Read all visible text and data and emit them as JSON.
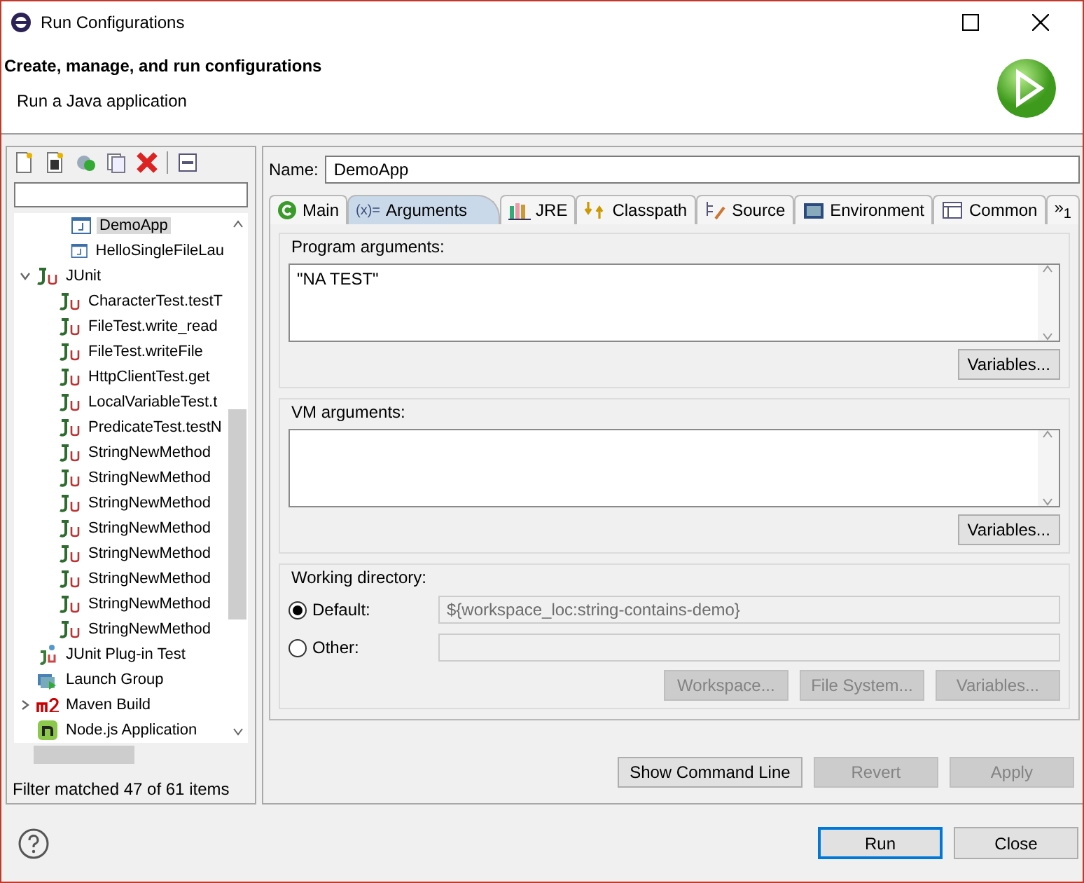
{
  "window": {
    "title": "Run Configurations"
  },
  "header": {
    "title": "Create, manage, and run configurations",
    "subtitle": "Run a Java application"
  },
  "toolbar": {
    "buttons": [
      {
        "kind": "new"
      },
      {
        "kind": "prototype"
      },
      {
        "kind": "duplicate"
      },
      {
        "kind": "export"
      },
      {
        "kind": "delete"
      },
      {
        "kind": "collapse"
      }
    ]
  },
  "tree": [
    {
      "children": [
        {
          "label": "DemoApp",
          "kind": "java",
          "selected": true
        },
        {
          "label": "HelloSingleFileLau",
          "kind": "java",
          "selected": false
        }
      ]
    },
    {
      "label": "JUnit",
      "kind": "junit",
      "selected": false,
      "expanded": true,
      "children": [
        {
          "label": "CharacterTest.testT",
          "kind": "junit",
          "selected": false
        },
        {
          "label": "FileTest.write_read",
          "kind": "junit",
          "selected": false
        },
        {
          "label": "FileTest.writeFile",
          "kind": "junit",
          "selected": false
        },
        {
          "label": "HttpClientTest.get",
          "kind": "junit",
          "selected": false
        },
        {
          "label": "LocalVariableTest.t",
          "kind": "junit",
          "selected": false
        },
        {
          "label": "PredicateTest.testN",
          "kind": "junit",
          "selected": false
        },
        {
          "label": "StringNewMethod",
          "kind": "junit",
          "selected": false
        },
        {
          "label": "StringNewMethod",
          "kind": "junit",
          "selected": false
        },
        {
          "label": "StringNewMethod",
          "kind": "junit",
          "selected": false
        },
        {
          "label": "StringNewMethod",
          "kind": "junit",
          "selected": false
        },
        {
          "label": "StringNewMethod",
          "kind": "junit",
          "selected": false
        },
        {
          "label": "StringNewMethod",
          "kind": "junit",
          "selected": false
        },
        {
          "label": "StringNewMethod",
          "kind": "junit",
          "selected": false
        },
        {
          "label": "StringNewMethod",
          "kind": "junit",
          "selected": false
        }
      ]
    },
    {
      "label": "JUnit Plug-in Test",
      "kind": "plugin",
      "selected": false
    },
    {
      "label": "Launch Group",
      "kind": "group",
      "selected": false
    },
    {
      "label": "Maven Build",
      "kind": "maven",
      "selected": false,
      "expanded": false
    },
    {
      "label": "Node.js Application",
      "kind": "node",
      "selected": false
    }
  ],
  "filter_status": "Filter matched 47 of 61 items",
  "name_field": {
    "label": "Name:",
    "value": "DemoApp"
  },
  "tabs": [
    {
      "label": "Main",
      "kind": "main",
      "selected": false
    },
    {
      "label": "Arguments",
      "kind": "args",
      "icon": "(x)=",
      "selected": true
    },
    {
      "label": "JRE",
      "kind": "jre",
      "selected": false
    },
    {
      "label": "Classpath",
      "kind": "classpath",
      "selected": false
    },
    {
      "label": "Source",
      "kind": "source",
      "selected": false
    },
    {
      "label": "Environment",
      "kind": "env",
      "selected": false
    },
    {
      "label": "Common",
      "kind": "common",
      "selected": false
    },
    {
      "label": "»$_{1}$",
      "kind": "more",
      "selected": false
    }
  ],
  "program_arguments": {
    "label": "Program arguments:",
    "value": "\"NA TEST\"",
    "button": "Variables..."
  },
  "vm_arguments": {
    "label": "VM arguments:",
    "button": "Variables..."
  },
  "working_directory": {
    "label": "Working directory:",
    "options": [
      {
        "label": "Default:",
        "selected": true,
        "value": "${workspace_loc:string-contains-demo}"
      },
      {
        "label": "Other:",
        "selected": false
      }
    ],
    "buttons": [
      {
        "label": "Workspace...",
        "disabled": true
      },
      {
        "label": "File System...",
        "disabled": true
      },
      {
        "label": "Variables...",
        "disabled": true
      }
    ]
  },
  "action_buttons": [
    {
      "label": "Show Command Line",
      "disabled": false
    },
    {
      "label": "Revert",
      "disabled": true
    },
    {
      "label": "Apply",
      "disabled": true
    }
  ],
  "footer_buttons": [
    {
      "label": "Run",
      "default": true
    },
    {
      "label": "Close",
      "default": false
    }
  ]
}
